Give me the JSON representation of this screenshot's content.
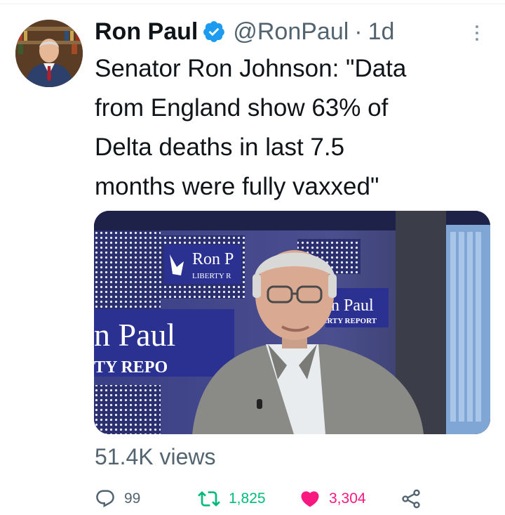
{
  "tweet": {
    "display_name": "Ron Paul",
    "handle": "@RonPaul",
    "separator": "·",
    "time": "1d",
    "text_lines": [
      "Senator Ron Johnson: \"Data",
      "from England show 63% of",
      "Delta deaths in last 7.5",
      "months were fully vaxxed\""
    ],
    "views": "51.4K views",
    "media": {
      "backdrop_logo": {
        "small_top": "Ron P",
        "small_top_sub": "LIBERTY R",
        "large": "n Paul",
        "large_sub": "TY REPO",
        "right": "n Paul",
        "right_sub": "ERTY REPORT"
      }
    }
  },
  "actions": {
    "reply": {
      "icon": "reply-icon",
      "count": "99"
    },
    "retweet": {
      "icon": "retweet-icon",
      "count": "1,825"
    },
    "like": {
      "icon": "heart-filled-icon",
      "count": "3,304"
    },
    "share": {
      "icon": "share-icon"
    }
  },
  "colors": {
    "text": "#0f1419",
    "muted": "#536471",
    "verified": "#1d9bf0",
    "retweet": "#00ba7c",
    "like": "#f91880"
  }
}
